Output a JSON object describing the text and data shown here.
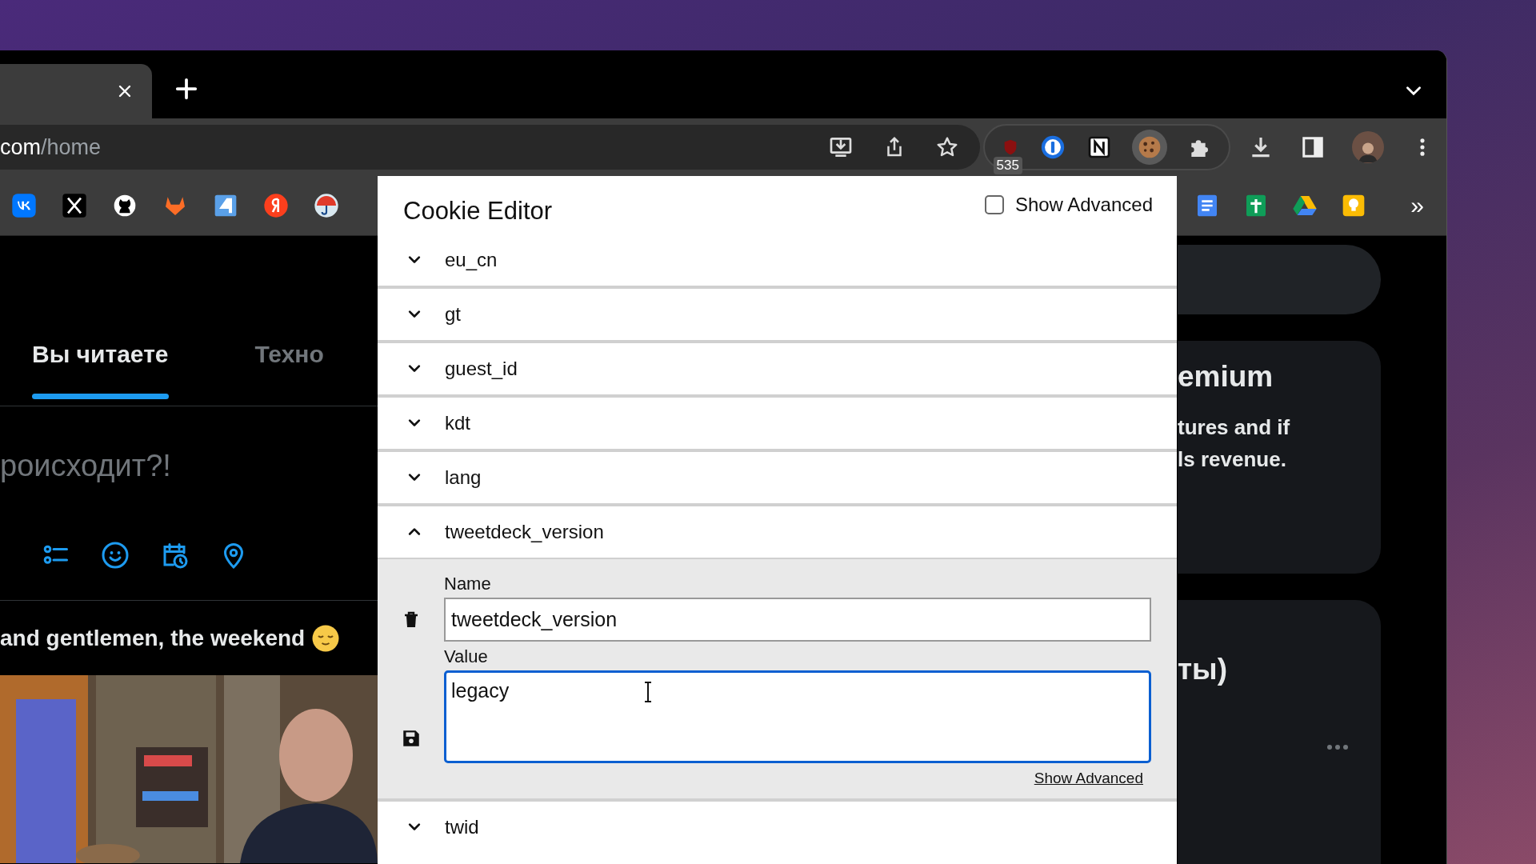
{
  "browser": {
    "address": {
      "host": "com",
      "path": "/home"
    },
    "extension_badge": "535",
    "bookmarks_overflow": "»"
  },
  "page": {
    "tabs": [
      {
        "label": "Вы читаете",
        "selected": true
      },
      {
        "label": "Техно",
        "selected": false
      }
    ],
    "compose": {
      "placeholder": "роисходит?!"
    },
    "tweet": {
      "text": "and gentlemen, the weekend"
    },
    "sidebar": {
      "premium_title": "emium",
      "premium_lines": [
        "tures and if",
        "ls revenue."
      ],
      "card_title": "ты)"
    }
  },
  "popup": {
    "title": "Cookie Editor",
    "show_advanced": {
      "label": "Show Advanced",
      "checked": false
    },
    "cookies": [
      {
        "name": "eu_cn",
        "expanded": false
      },
      {
        "name": "gt",
        "expanded": false
      },
      {
        "name": "guest_id",
        "expanded": false
      },
      {
        "name": "kdt",
        "expanded": false
      },
      {
        "name": "lang",
        "expanded": false
      },
      {
        "name": "tweetdeck_version",
        "expanded": true,
        "fields": {
          "name_label": "Name",
          "name_value": "tweetdeck_version",
          "value_label": "Value",
          "value": "legacy",
          "advanced_link": "Show Advanced"
        }
      },
      {
        "name": "twid",
        "expanded": false
      }
    ]
  }
}
